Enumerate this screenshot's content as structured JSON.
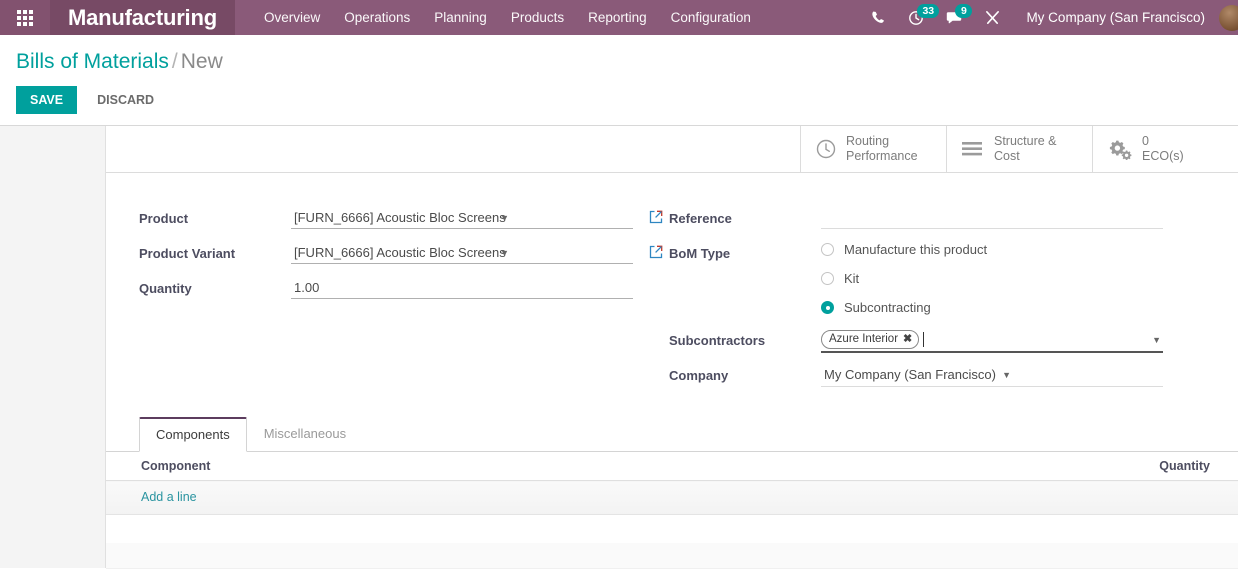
{
  "navbar": {
    "apps_icon": "apps-grid-icon",
    "brand": "Manufacturing",
    "menu": [
      {
        "label": "Overview"
      },
      {
        "label": "Operations"
      },
      {
        "label": "Planning"
      },
      {
        "label": "Products"
      },
      {
        "label": "Reporting"
      },
      {
        "label": "Configuration"
      }
    ],
    "tray": {
      "phone_icon": "phone-icon",
      "activity_icon": "clock-activity-icon",
      "activity_count": "33",
      "messages_icon": "chat-bubble-icon",
      "messages_count": "9",
      "debug_icon": "tools-wrench-icon",
      "company": "My Company (San Francisco)",
      "avatar": "user-avatar"
    },
    "accent_purple": "#8a5a79",
    "brand_purple": "#774a65"
  },
  "control_panel": {
    "breadcrumb_root": "Bills of Materials",
    "breadcrumb_sep": "/",
    "breadcrumb_current": "New",
    "save_label": "SAVE",
    "discard_label": "DISCARD",
    "accent_teal": "#00a09d"
  },
  "stat_buttons": [
    {
      "icon": "clock-icon",
      "line1": "Routing",
      "line2": "Performance"
    },
    {
      "icon": "list-bars-icon",
      "line1": "Structure &",
      "line2": "Cost"
    },
    {
      "icon": "gears-icon",
      "line1": "0",
      "line2": "ECO(s)"
    }
  ],
  "form": {
    "left": {
      "product_label": "Product",
      "product_value": "[FURN_6666] Acoustic Bloc Screens",
      "product_variant_label": "Product Variant",
      "product_variant_value": "[FURN_6666] Acoustic Bloc Screens",
      "quantity_label": "Quantity",
      "quantity_value": "1.00"
    },
    "right": {
      "reference_label": "Reference",
      "reference_value": "",
      "bom_type_label": "BoM Type",
      "bom_type_options": [
        {
          "label": "Manufacture this product",
          "selected": false
        },
        {
          "label": "Kit",
          "selected": false
        },
        {
          "label": "Subcontracting",
          "selected": true
        }
      ],
      "subcontractors_label": "Subcontractors",
      "subcontractor_tags": [
        {
          "label": "Azure Interior",
          "remove": "✖"
        }
      ],
      "company_label": "Company",
      "company_value": "My Company (San Francisco)"
    }
  },
  "notebook": {
    "tabs": [
      {
        "label": "Components",
        "active": true
      },
      {
        "label": "Miscellaneous",
        "active": false
      }
    ],
    "columns": {
      "component": "Component",
      "quantity": "Quantity"
    },
    "add_line_label": "Add a line"
  }
}
